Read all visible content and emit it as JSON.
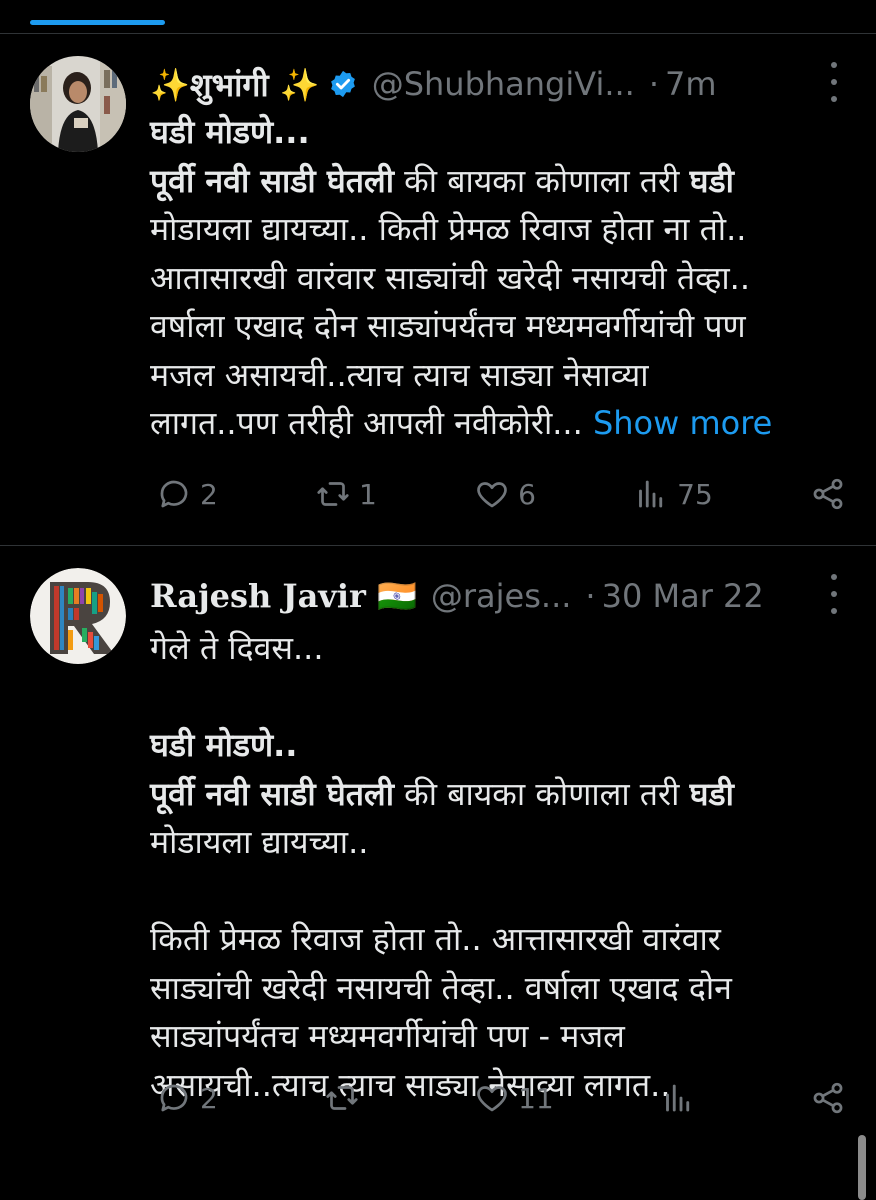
{
  "tweets": [
    {
      "author_name": "✨शुभांगी ✨",
      "handle": "@ShubhangiVi...",
      "separator": "·",
      "time": "7m",
      "lines": [
        [
          {
            "t": "घडी मोडणे...",
            "b": true
          }
        ],
        [
          {
            "t": "पूर्वी नवी साडी घेतली",
            "b": true
          },
          {
            "t": " की बायका कोणाला तरी "
          },
          {
            "t": "घडी",
            "b": true
          }
        ],
        [
          {
            "t": "मोडायला द्यायच्या.. किती प्रेमळ रिवाज होता ना तो.."
          }
        ],
        [
          {
            "t": "आतासारखी वारंवार साड्यांची खरेदी नसायची तेव्हा.."
          }
        ],
        [
          {
            "t": "वर्षाला एखाद दोन साड्यांपर्यंतच मध्यमवर्गीयांची पण"
          }
        ],
        [
          {
            "t": "मजल असायची..त्याच त्याच साड्या नेसाव्या"
          }
        ],
        [
          {
            "t": "लागत..पण तरीही आपली नवीकोरी... "
          },
          {
            "t": "Show more",
            "link": true
          }
        ]
      ],
      "stats": {
        "replies": "2",
        "retweets": "1",
        "likes": "6",
        "views": "75"
      }
    },
    {
      "author_name": "Rajesh Javir 🇮🇳",
      "handle": "@rajes...",
      "separator": "·",
      "time": "30 Mar 22",
      "lines": [
        [
          {
            "t": "गेले ते दिवस..."
          }
        ],
        [],
        [
          {
            "t": "घडी मोडणे..",
            "b": true
          }
        ],
        [
          {
            "t": "पूर्वी नवी साडी घेतली",
            "b": true
          },
          {
            "t": " की बायका कोणाला तरी "
          },
          {
            "t": "घडी",
            "b": true
          }
        ],
        [
          {
            "t": "मोडायला द्यायच्या.."
          }
        ],
        [],
        [
          {
            "t": "किती प्रेमळ रिवाज होता तो.. आत्तासारखी वारंवार"
          }
        ],
        [
          {
            "t": "साड्यांची खरेदी नसायची तेव्हा.. वर्षाला एखाद दोन"
          }
        ],
        [
          {
            "t": "साड्यांपर्यंतच मध्यमवर्गीयांची पण - मजल"
          }
        ],
        [
          {
            "t": "असायची..त्याच त्याच साड्या नेसाव्या लागत.."
          }
        ]
      ],
      "stats": {
        "replies": "2",
        "retweets": "",
        "likes": "11",
        "views": ""
      }
    }
  ],
  "icons": {
    "reply": "reply-icon",
    "retweet": "retweet-icon",
    "like": "heart-icon",
    "views": "analytics-icon",
    "share": "share-icon",
    "more": "more-dots-icon",
    "verified": "verified-badge-icon"
  },
  "colors": {
    "background": "#000000",
    "text": "#e7e9ea",
    "muted": "#71767b",
    "accent": "#1d9bf0",
    "divider": "#2f3336"
  }
}
